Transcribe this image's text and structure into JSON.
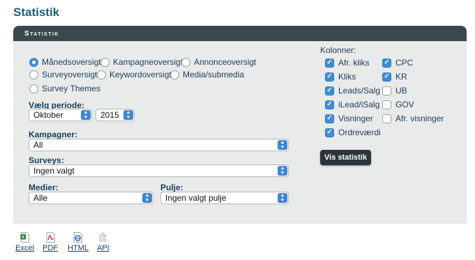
{
  "page": {
    "title": "Statistik"
  },
  "panel": {
    "header": "Statistik"
  },
  "report_types": [
    {
      "label": "Månedsoversigt",
      "checked": true
    },
    {
      "label": "Kampagneoversigt",
      "checked": false
    },
    {
      "label": "Annonceoversigt",
      "checked": false
    },
    {
      "label": "Surveyoversigt",
      "checked": false
    },
    {
      "label": "Keywordoversigt",
      "checked": false
    },
    {
      "label": "Media/submedia",
      "checked": false
    },
    {
      "label": "Survey Themes",
      "checked": false
    }
  ],
  "period": {
    "label": "Vælg periode:",
    "month": "Oktober",
    "year": "2015"
  },
  "kampagner": {
    "label": "Kampagner:",
    "value": "All"
  },
  "surveys": {
    "label": "Surveys:",
    "value": "Ingen valgt"
  },
  "medier": {
    "label": "Medier:",
    "value": "Alle"
  },
  "pulje": {
    "label": "Pulje:",
    "value": "Ingen valgt pulje"
  },
  "columns": {
    "label": "Kolonner:",
    "left": [
      {
        "label": "Afr. kliks",
        "checked": true
      },
      {
        "label": "Kliks",
        "checked": true
      },
      {
        "label": "Leads/Salg",
        "checked": true
      },
      {
        "label": "iLead/iSalg",
        "checked": true
      },
      {
        "label": "Visninger",
        "checked": true
      },
      {
        "label": "Ordreværdi",
        "checked": true
      }
    ],
    "right": [
      {
        "label": "CPC",
        "checked": true
      },
      {
        "label": "KR",
        "checked": true
      },
      {
        "label": "UB",
        "checked": false
      },
      {
        "label": "GOV",
        "checked": false
      },
      {
        "label": "Afr. visninger",
        "checked": false
      }
    ]
  },
  "vis_button": "Vis statistik",
  "exports": [
    {
      "label": "Excel",
      "icon": "excel-icon",
      "color": "#1d7a3a"
    },
    {
      "label": "PDF",
      "icon": "pdf-icon",
      "color": "#d22b2b"
    },
    {
      "label": "HTML",
      "icon": "html-icon",
      "color": "#2a72c4"
    },
    {
      "label": "API",
      "icon": "api-icon",
      "color": "#b8b8b8"
    }
  ],
  "colors": {
    "header_bg": "#39484b",
    "panel_bg": "#e9eaea",
    "accent": "#3d8ed8",
    "title": "#1e5a7a"
  }
}
